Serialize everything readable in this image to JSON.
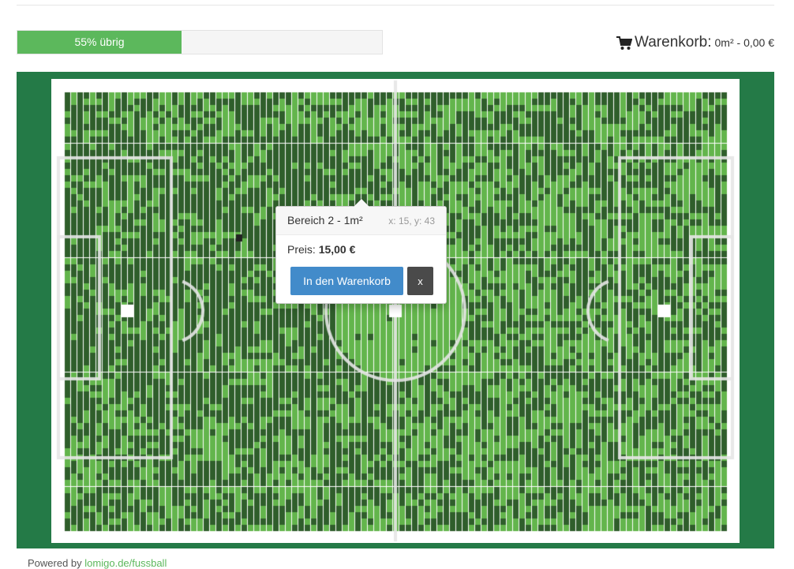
{
  "progress": {
    "label": "55% übrig",
    "remaining_fraction": 0.55,
    "fill_fraction": 0.45
  },
  "cart": {
    "icon": "shopping-cart-icon",
    "label": "Warenkorb:",
    "value": "0m² - 0,00 €"
  },
  "popover": {
    "title": "Bereich 2 - 1m²",
    "coords": "x: 15, y: 43",
    "price_label": "Preis:",
    "price_value": "15,00 €",
    "add_button": "In den Warenkorb",
    "close_button": "x"
  },
  "footer": {
    "prefix": "Powered by",
    "link": "lomigo.de/fussball"
  },
  "colors": {
    "sold": "#2f5e2b",
    "free": "#63b54c",
    "pitch_background": "#247a47",
    "accent": "#5cb85c",
    "primary": "#428bca"
  }
}
